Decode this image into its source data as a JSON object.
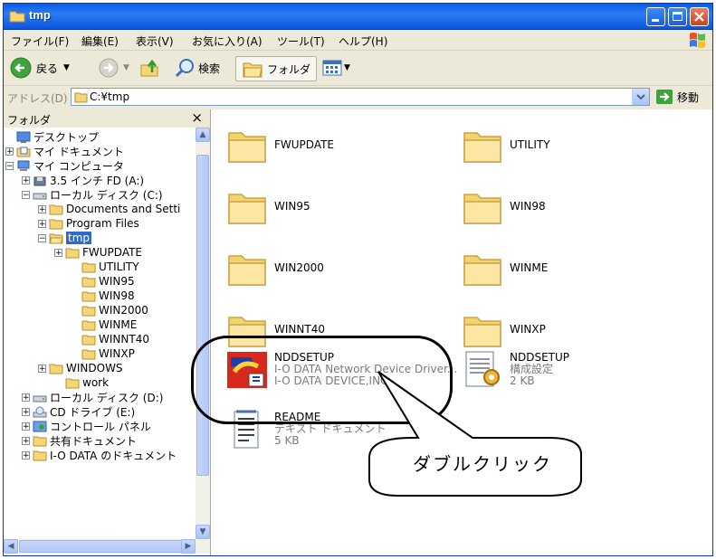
{
  "window": {
    "title": "tmp"
  },
  "menu": [
    "ファイル(F)",
    "編集(E)",
    "表示(V)",
    "お気に入り(A)",
    "ツール(T)",
    "ヘルプ(H)"
  ],
  "toolbar": {
    "back": "戻る",
    "search": "検索",
    "folders": "フォルダ"
  },
  "address": {
    "label": "アドレス(D)",
    "value": "C:¥tmp",
    "go": "移動"
  },
  "left_pane": {
    "title": "フォルダ",
    "close": "×",
    "tree": [
      {
        "label": "デスクトップ",
        "icon": "desktop-icon",
        "selected": false
      },
      {
        "label": "マイ ドキュメント",
        "icon": "documents-icon",
        "selected": false
      },
      {
        "label": "マイ コンピュータ",
        "icon": "computer-icon",
        "selected": false
      },
      {
        "label": "3.5 インチ FD (A:)",
        "icon": "floppy-icon",
        "selected": false
      },
      {
        "label": "ローカル ディスク (C:)",
        "icon": "drive-icon",
        "selected": false
      },
      {
        "label": "Documents and Setti",
        "icon": "folder-icon",
        "selected": false
      },
      {
        "label": "Program Files",
        "icon": "folder-icon",
        "selected": false
      },
      {
        "label": "tmp",
        "icon": "folder-open-icon",
        "selected": true
      },
      {
        "label": "FWUPDATE",
        "icon": "folder-icon",
        "selected": false
      },
      {
        "label": "UTILITY",
        "icon": "folder-icon",
        "selected": false
      },
      {
        "label": "WIN95",
        "icon": "folder-icon",
        "selected": false
      },
      {
        "label": "WIN98",
        "icon": "folder-icon",
        "selected": false
      },
      {
        "label": "WIN2000",
        "icon": "folder-icon",
        "selected": false
      },
      {
        "label": "WINME",
        "icon": "folder-icon",
        "selected": false
      },
      {
        "label": "WINNT40",
        "icon": "folder-icon",
        "selected": false
      },
      {
        "label": "WINXP",
        "icon": "folder-icon",
        "selected": false
      },
      {
        "label": "WINDOWS",
        "icon": "folder-icon",
        "selected": false
      },
      {
        "label": "work",
        "icon": "folder-icon",
        "selected": false
      },
      {
        "label": "ローカル ディスク (D:)",
        "icon": "drive-icon",
        "selected": false
      },
      {
        "label": "CD ドライブ (E:)",
        "icon": "cd-icon",
        "selected": false
      },
      {
        "label": "コントロール パネル",
        "icon": "control-panel-icon",
        "selected": false
      },
      {
        "label": "共有ドキュメント",
        "icon": "folder-icon",
        "selected": false
      },
      {
        "label": "I-O DATA のドキュメント",
        "icon": "folder-icon",
        "selected": false
      }
    ]
  },
  "content": {
    "folders": [
      "FWUPDATE",
      "UTILITY",
      "WIN95",
      "WIN98",
      "WIN2000",
      "WINME",
      "WINNT40",
      "WINXP"
    ],
    "files": [
      {
        "name": "NDDSETUP",
        "line2": "I-O DATA Network Device Driver...",
        "line3": "I-O DATA DEVICE,INC.",
        "icon": "installer-icon"
      },
      {
        "name": "NDDSETUP",
        "line2": "構成設定",
        "line3": "2 KB",
        "icon": "config-file-icon"
      },
      {
        "name": "README",
        "line2": "テキスト ドキュメント",
        "line3": "5 KB",
        "icon": "text-file-icon"
      }
    ]
  },
  "annotation": {
    "text": "ダブルクリック"
  }
}
